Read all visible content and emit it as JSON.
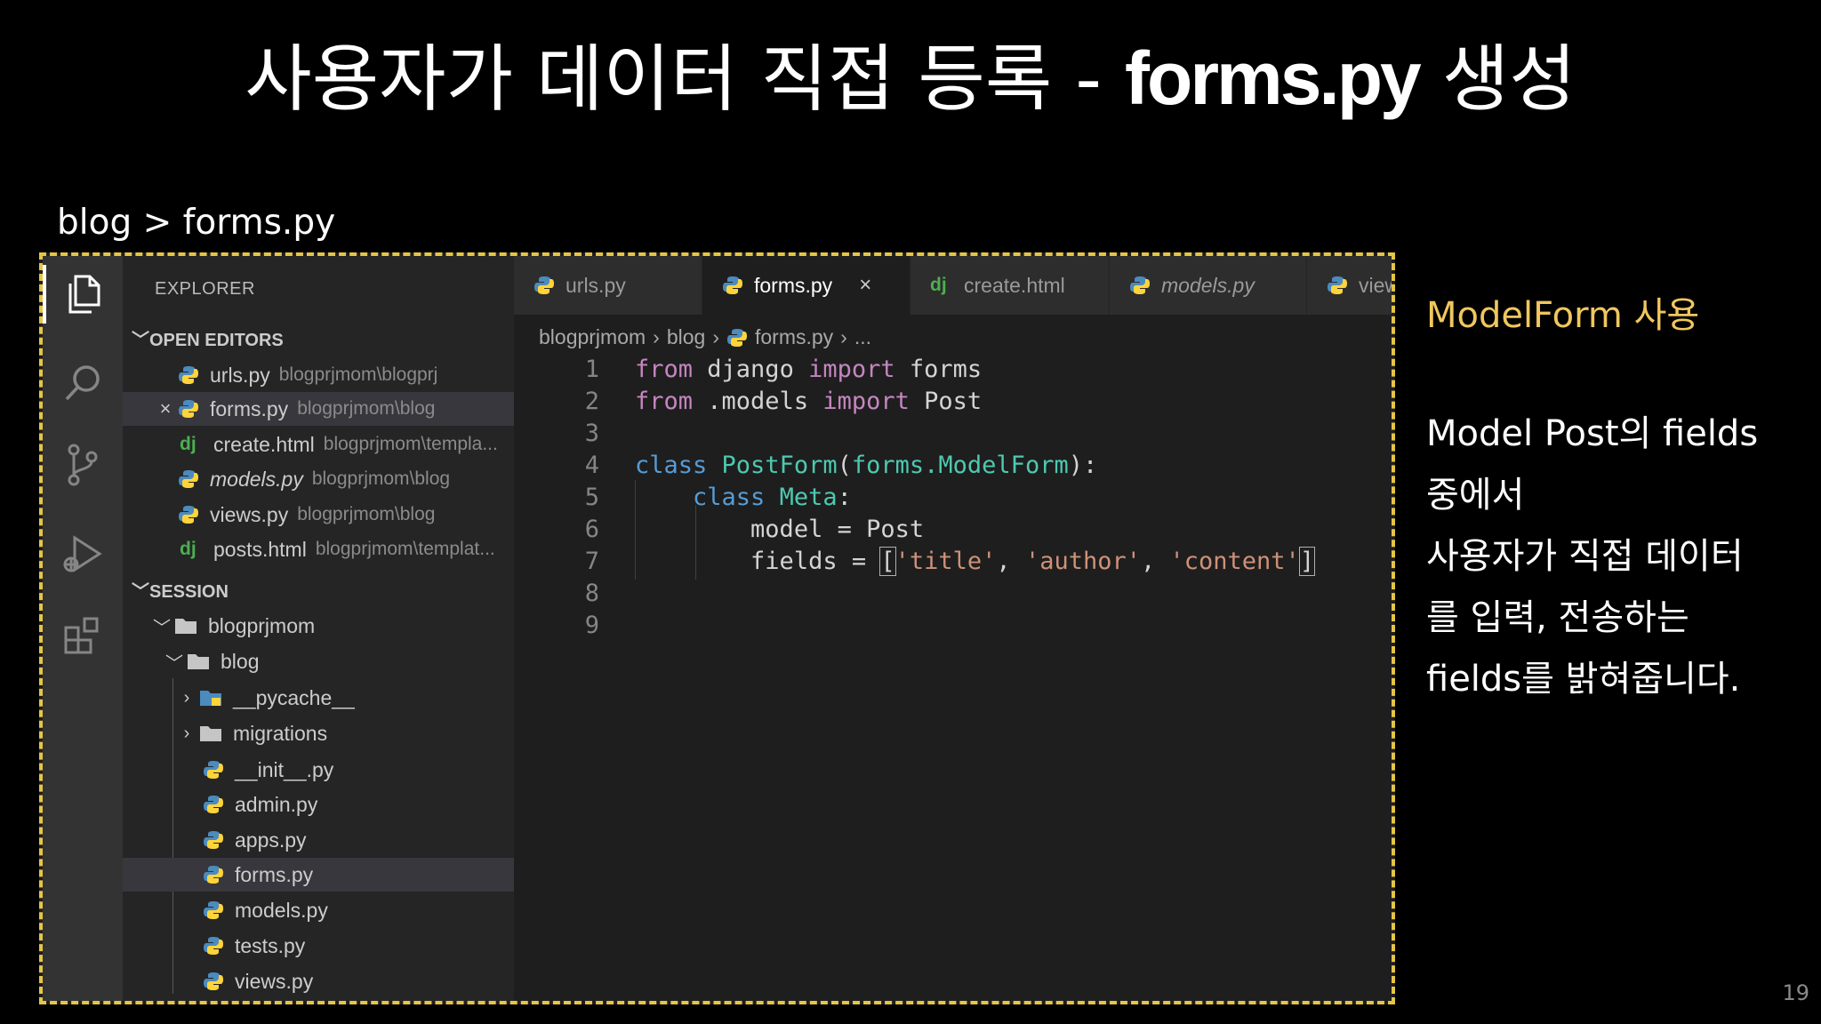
{
  "slide": {
    "title_prefix": "사용자가 데이터 직접 등록 - ",
    "title_code": "forms.py",
    "title_suffix": " 생성",
    "file_path": "blog > forms.py",
    "page_number": "19"
  },
  "side_note": {
    "heading": "ModelForm 사용",
    "lines": [
      "Model Post의 fields",
      "중에서",
      "사용자가 직접 데이터",
      "를 입력, 전송하는",
      "fields를 밝혀줍니다."
    ]
  },
  "activity_bar": {
    "icons": [
      "explorer-icon",
      "search-icon",
      "source-control-icon",
      "run-debug-icon",
      "extensions-icon"
    ]
  },
  "explorer": {
    "title": "EXPLORER",
    "open_editors_label": "OPEN EDITORS",
    "open_editors": [
      {
        "name": "urls.py",
        "path": "blogprjmom\\blogprj",
        "type": "py"
      },
      {
        "name": "forms.py",
        "path": "blogprjmom\\blog",
        "type": "py",
        "selected": true
      },
      {
        "name": "create.html",
        "path": "blogprjmom\\templa...",
        "type": "dj"
      },
      {
        "name": "models.py",
        "path": "blogprjmom\\blog",
        "type": "py",
        "italic": true
      },
      {
        "name": "views.py",
        "path": "blogprjmom\\blog",
        "type": "py"
      },
      {
        "name": "posts.html",
        "path": "blogprjmom\\templat...",
        "type": "dj"
      }
    ],
    "session_label": "SESSION",
    "tree": {
      "root": "blogprjmom",
      "folder": "blog",
      "subfolders": [
        "__pycache__",
        "migrations"
      ],
      "files": [
        "__init__.py",
        "admin.py",
        "apps.py",
        "forms.py",
        "models.py",
        "tests.py",
        "views.py"
      ]
    }
  },
  "tabs": [
    {
      "label": "urls.py",
      "type": "py"
    },
    {
      "label": "forms.py",
      "type": "py",
      "active": true,
      "close": "×"
    },
    {
      "label": "create.html",
      "type": "dj"
    },
    {
      "label": "models.py",
      "type": "py",
      "italic": true
    },
    {
      "label": "views.py",
      "type": "py"
    }
  ],
  "breadcrumb": {
    "parts": [
      "blogprjmom",
      "blog",
      "forms.py",
      "..."
    ]
  },
  "code": {
    "line_numbers": [
      "1",
      "2",
      "3",
      "4",
      "5",
      "6",
      "7",
      "8",
      "9"
    ],
    "tokens": {
      "from": "from",
      "import": "import",
      "django": " django ",
      "forms": " forms",
      "dot_models": " .models ",
      "post": " Post",
      "class": "class",
      "postform": "PostForm",
      "lparen": "(",
      "forms_mod": "forms.",
      "modelform": "ModelForm",
      "rparen_colon": "):",
      "meta": "Meta",
      "colon": ":",
      "model_line": "model = Post",
      "fields_eq": "fields = ",
      "lbr": "[",
      "title": "'title'",
      "author": "'author'",
      "content": "'content'",
      "comma": ", ",
      "rbr": "]"
    }
  }
}
